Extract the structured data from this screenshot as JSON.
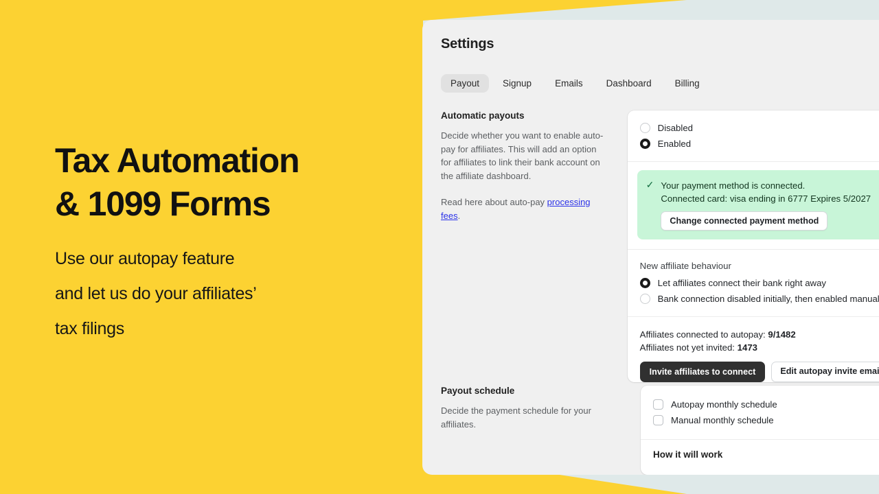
{
  "theme": {
    "yellow": "#fcd232",
    "background": "#dfe9e9",
    "panel_bg": "#f0f0f0",
    "card_bg": "#ffffff",
    "success_bg": "#c8f5d8",
    "link_color": "#2b32e8",
    "primary_button": "#303030"
  },
  "promo": {
    "headline_line1": "Tax Automation",
    "headline_line2": "& 1099 Forms",
    "subhead_line1": "Use our autopay feature",
    "subhead_line2": "and let us do your affiliates’",
    "subhead_line3": "tax filings"
  },
  "panel": {
    "title": "Settings",
    "tabs": [
      {
        "label": "Payout",
        "active": true
      },
      {
        "label": "Signup",
        "active": false
      },
      {
        "label": "Emails",
        "active": false
      },
      {
        "label": "Dashboard",
        "active": false
      },
      {
        "label": "Billing",
        "active": false
      }
    ]
  },
  "automatic_payouts": {
    "title": "Automatic payouts",
    "description": "Decide whether you want to enable auto-pay for affiliates. This will add an option for affiliates to link their bank account on the affiliate dashboard.",
    "link_prefix": "Read here about auto-pay ",
    "link_text": "processing fees",
    "link_suffix": ".",
    "options": [
      {
        "label": "Disabled",
        "selected": false
      },
      {
        "label": "Enabled",
        "selected": true
      }
    ],
    "banner": {
      "icon": "check-icon",
      "line1": "Your payment method is connected.",
      "line2": "Connected card: visa ending in 6777 Expires 5/2027",
      "button_label": "Change connected payment method"
    },
    "behaviour": {
      "label": "New affiliate behaviour",
      "options": [
        {
          "label": "Let affiliates connect their bank right away",
          "selected": true
        },
        {
          "label": "Bank connection disabled initially, then enabled manually",
          "selected": false
        }
      ]
    },
    "stats": {
      "connected_label": "Affiliates connected to autopay:",
      "connected_value": "9/1482",
      "not_invited_label": "Affiliates not yet invited:",
      "not_invited_value": "1473",
      "primary_button": "Invite affiliates to connect",
      "secondary_button": "Edit autopay invite email"
    }
  },
  "payout_schedule": {
    "title": "Payout schedule",
    "description": "Decide the payment schedule for your affiliates.",
    "options": [
      {
        "label": "Autopay monthly schedule",
        "checked": false
      },
      {
        "label": "Manual monthly schedule",
        "checked": false
      }
    ],
    "how_it_works_title": "How it will work"
  }
}
